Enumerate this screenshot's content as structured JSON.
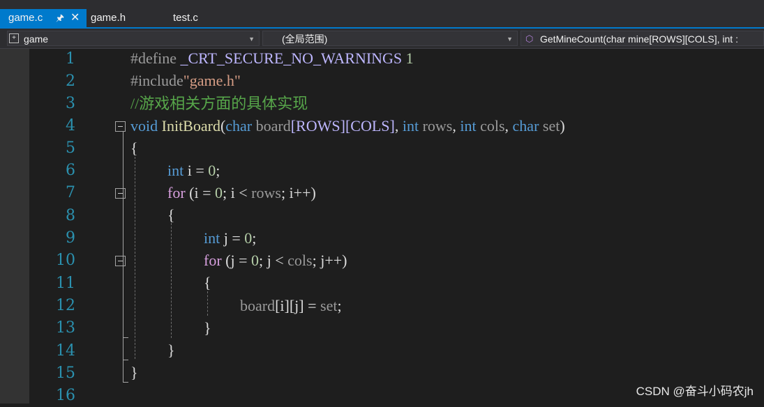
{
  "tabs": [
    {
      "label": "game.c",
      "pin": "↕",
      "close": "✕",
      "active": true
    },
    {
      "label": "game.h"
    },
    {
      "label": "test.c"
    }
  ],
  "navbar": {
    "project": "game",
    "scope": "(全局范围)",
    "member": "GetMineCount(char mine[ROWS][COLS], int :"
  },
  "line_numbers": [
    "1",
    "2",
    "3",
    "4",
    "5",
    "6",
    "7",
    "8",
    "9",
    "10",
    "11",
    "12",
    "13",
    "14",
    "15",
    "16"
  ],
  "code": {
    "l1": {
      "directive": "#define",
      "macro": "_CRT_SECURE_NO_WARNINGS",
      "value": "1"
    },
    "l2": {
      "directive": "#include",
      "header": "\"game.h\""
    },
    "l3": {
      "comment": "//游戏相关方面的具体实现"
    },
    "l4": {
      "ret": "void",
      "name": "InitBoard",
      "open": "(",
      "t1": "char",
      "p1": "board",
      "d1": "[ROWS][COLS]",
      "c1": ", ",
      "t2": "int",
      "p2": "rows",
      "c2": ", ",
      "t3": "int",
      "p3": "cols",
      "c3": ", ",
      "t4": "char",
      "p4": "set",
      "close": ")"
    },
    "l5": "{",
    "l6": {
      "type": "int",
      "rest1": " i = ",
      "num": "0",
      "rest2": ";"
    },
    "l7": {
      "kw": "for",
      "a": " (i = ",
      "num": "0",
      "b": "; i < ",
      "c": "rows",
      "d": "; i++)"
    },
    "l8": "{",
    "l9": {
      "type": "int",
      "rest1": " j = ",
      "num": "0",
      "rest2": ";"
    },
    "l10": {
      "kw": "for",
      "a": " (j = ",
      "num": "0",
      "b": "; j < ",
      "c": "cols",
      "d": "; j++)"
    },
    "l11": "{",
    "l12": {
      "a": "board",
      "b": "[i][j] = ",
      "c": "set",
      "d": ";"
    },
    "l13": "}",
    "l14": "}",
    "l15": "}"
  },
  "watermark": "CSDN @奋斗小码农jh",
  "icons": {
    "project": "project-icon",
    "method": "method-cube-icon",
    "dropdown": "chevron-down-icon",
    "fold": "collapse-minus-icon"
  },
  "colors": {
    "accent": "#007acc",
    "keyword": "#569cd6",
    "control": "#d8a0df",
    "comment": "#57a64a",
    "function": "#dcdcaa",
    "number": "#b5cea8",
    "line_number": "#2b91af"
  }
}
